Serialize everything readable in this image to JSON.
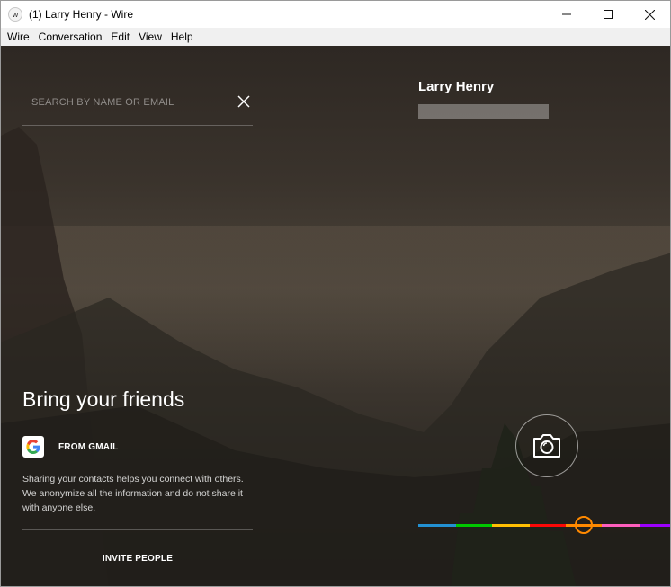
{
  "window": {
    "title": "(1) Larry Henry - Wire",
    "app_icon_glyph": "w",
    "controls": {
      "minimize_icon": "minimize-icon",
      "maximize_icon": "maximize-icon",
      "close_icon": "close-icon"
    }
  },
  "menu": {
    "items": [
      "Wire",
      "Conversation",
      "Edit",
      "View",
      "Help"
    ]
  },
  "search": {
    "placeholder": "SEARCH BY NAME OR EMAIL",
    "value": "",
    "clear_icon": "close-icon"
  },
  "invite": {
    "title": "Bring your friends",
    "gmail_label": "FROM GMAIL",
    "gmail_icon": "google-icon",
    "privacy_text": "Sharing your contacts helps you connect with others. We anonymize all the information and do not share it with anyone else.",
    "invite_button": "INVITE PEOPLE"
  },
  "profile": {
    "name": "Larry Henry",
    "camera_icon": "camera-icon"
  },
  "accent": {
    "colors": [
      "#2391d3",
      "#00c800",
      "#febf02",
      "#fb0807",
      "#ff8900",
      "#fe5ebd",
      "#9c00fe"
    ],
    "selected_color": "#ff8900",
    "selected_index": 4
  }
}
